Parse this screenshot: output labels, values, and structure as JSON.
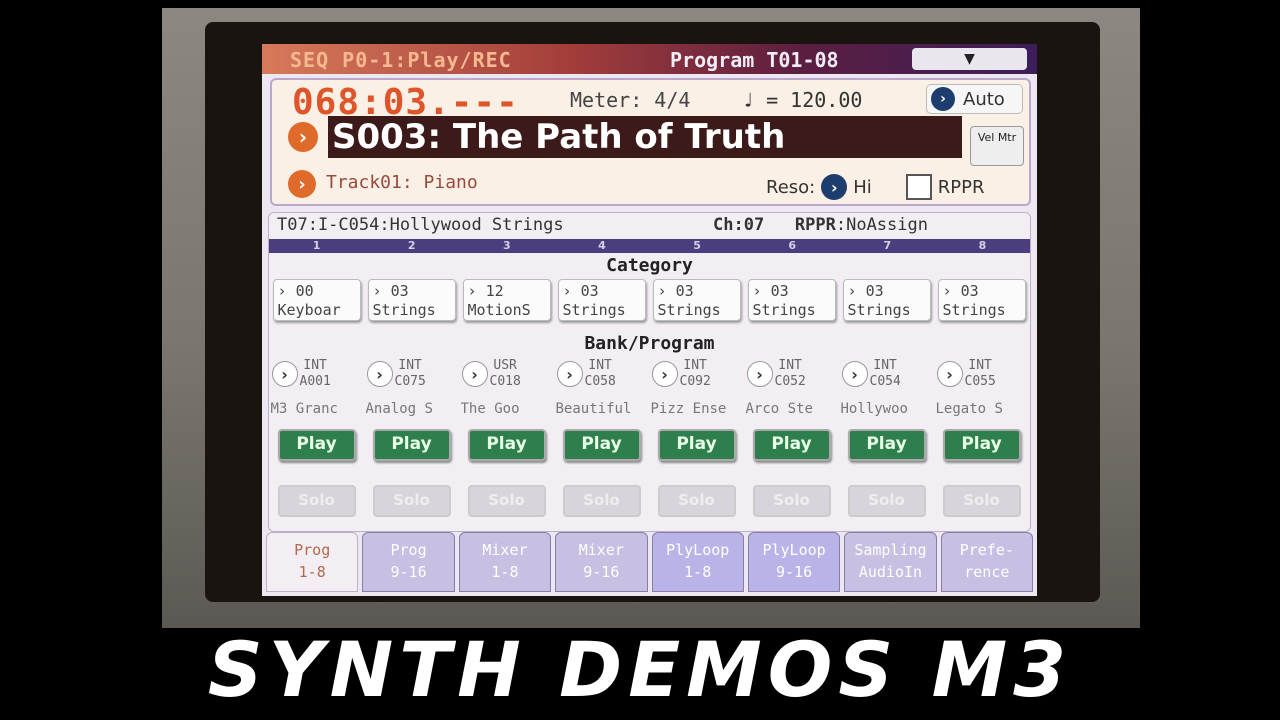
{
  "header": {
    "mode": "SEQ P0-1:Play/REC",
    "page_title": "Program T01-08",
    "dropdown_symbol": "▼"
  },
  "song": {
    "locator": "068:03.---",
    "meter": "Meter: 4/4",
    "tempo": "♩ = 120.00",
    "tempo_mode": "Auto",
    "name": "S003: The Path of Truth",
    "vel_mtr_label": "Vel Mtr",
    "track": "Track01: Piano",
    "reso_label": "Reso:",
    "reso_value": "Hi",
    "rppr_label": "RPPR"
  },
  "track_panel": {
    "track_info": "T07:I-C054:Hollywood Strings",
    "channel": "Ch:07",
    "rppr_label": "RPPR",
    "rppr_value": ":NoAssign",
    "numbers": [
      "1",
      "2",
      "3",
      "4",
      "5",
      "6",
      "7",
      "8"
    ],
    "category_label": "Category",
    "bank_label": "Bank/Program",
    "tracks": [
      {
        "cat_num": "00",
        "cat_name": "Keyboar",
        "bank": "INT",
        "prog": "A001",
        "pname": "M3 Granc"
      },
      {
        "cat_num": "03",
        "cat_name": "Strings",
        "bank": "INT",
        "prog": "C075",
        "pname": "Analog S"
      },
      {
        "cat_num": "12",
        "cat_name": "MotionS",
        "bank": "USR",
        "prog": "C018",
        "pname": "The Goo"
      },
      {
        "cat_num": "03",
        "cat_name": "Strings",
        "bank": "INT",
        "prog": "C058",
        "pname": "Beautiful"
      },
      {
        "cat_num": "03",
        "cat_name": "Strings",
        "bank": "INT",
        "prog": "C092",
        "pname": "Pizz Ense"
      },
      {
        "cat_num": "03",
        "cat_name": "Strings",
        "bank": "INT",
        "prog": "C052",
        "pname": "Arco Ste"
      },
      {
        "cat_num": "03",
        "cat_name": "Strings",
        "bank": "INT",
        "prog": "C054",
        "pname": "Hollywoo"
      },
      {
        "cat_num": "03",
        "cat_name": "Strings",
        "bank": "INT",
        "prog": "C055",
        "pname": "Legato S"
      }
    ],
    "play_label": "Play",
    "solo_label": "Solo"
  },
  "tabs": [
    {
      "line1": "Prog",
      "line2": "1-8"
    },
    {
      "line1": "Prog",
      "line2": "9-16"
    },
    {
      "line1": "Mixer",
      "line2": "1-8"
    },
    {
      "line1": "Mixer",
      "line2": "9-16"
    },
    {
      "line1": "PlyLoop",
      "line2": "1-8"
    },
    {
      "line1": "PlyLoop",
      "line2": "9-16"
    },
    {
      "line1": "Sampling",
      "line2": "AudioIn"
    },
    {
      "line1": "Prefe-",
      "line2": "rence"
    }
  ],
  "banner": "SYNTH DEMOS M3",
  "colors": {
    "locator": "#e0542a",
    "song_name_bg": "#3c1a1a",
    "play_button": "#2f7f4e",
    "track_number_bar": "#4c3e7e"
  }
}
